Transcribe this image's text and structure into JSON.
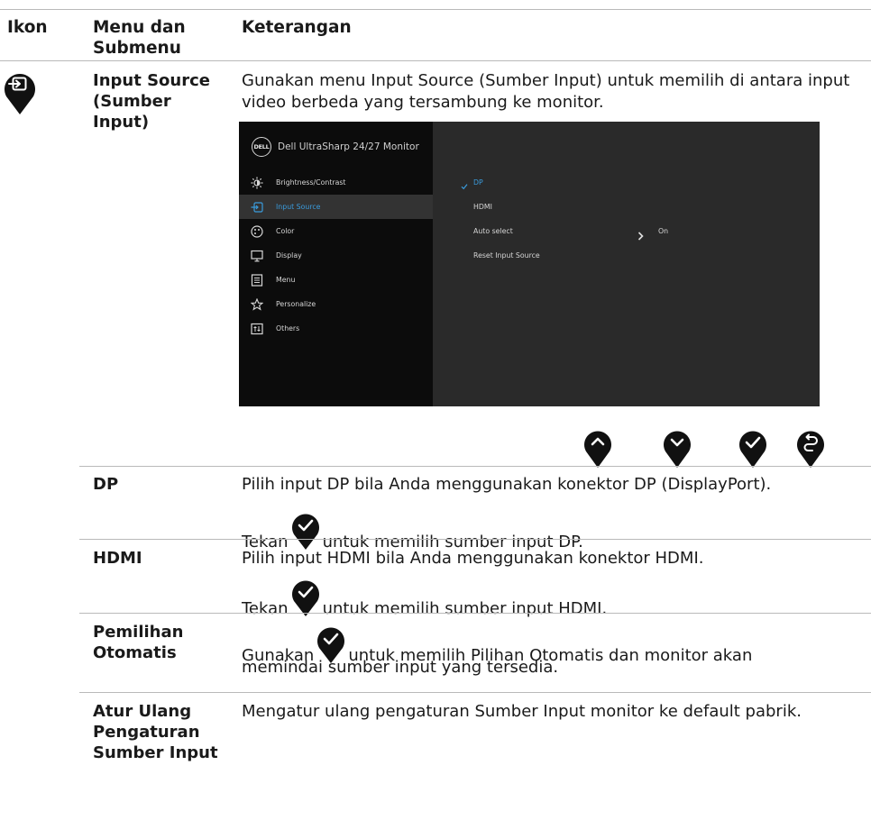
{
  "header": {
    "col_icon": "Ikon",
    "col_menu": "Menu dan Submenu",
    "col_desc": "Keterangan"
  },
  "input_source": {
    "title": "Input Source (Sumber Input)",
    "description": "Gunakan menu Input Source (Sumber Input) untuk memilih di antara input video berbeda yang tersambung ke monitor."
  },
  "osd": {
    "logo": "DELL",
    "title": "Dell UltraSharp 24/27 Monitor",
    "menu_items": [
      {
        "label": "Brightness/Contrast",
        "icon": "brightness-icon"
      },
      {
        "label": "Input Source",
        "icon": "input-source-icon"
      },
      {
        "label": "Color",
        "icon": "palette-icon"
      },
      {
        "label": "Display",
        "icon": "display-icon"
      },
      {
        "label": "Menu",
        "icon": "menu-icon"
      },
      {
        "label": "Personalize",
        "icon": "star-icon"
      },
      {
        "label": "Others",
        "icon": "others-icon"
      }
    ],
    "sub_items": [
      "DP",
      "HDMI",
      "Auto select",
      "Reset Input Source"
    ],
    "auto_select_value": "On",
    "selected": "DP"
  },
  "nav_buttons": [
    "up-icon",
    "down-icon",
    "check-icon",
    "back-icon"
  ],
  "rows": [
    {
      "label": "DP",
      "line1": "Pilih input DP bila Anda menggunakan konektor DP (DisplayPort).",
      "line2_before": "Tekan",
      "line2_after": "untuk memilih sumber input DP."
    },
    {
      "label": "HDMI",
      "line1": "Pilih input HDMI bila Anda menggunakan konektor HDMI.",
      "line2_before": "Tekan",
      "line2_after": "untuk memilih sumber input HDMI."
    },
    {
      "label": "Pemilihan Otomatis",
      "line1_before": "Gunakan",
      "line1_after": "untuk memilih Pilihan Otomatis dan monitor akan",
      "line2": "memindai sumber input yang tersedia."
    },
    {
      "label": "Atur Ulang Pengaturan Sumber Input",
      "line1": "Mengatur ulang pengaturan Sumber Input monitor ke default pabrik."
    }
  ],
  "colors": {
    "osd_background": "#0c0c0c",
    "osd_panel": "#2a2a2a",
    "osd_accent": "#3a9bdc",
    "pin": "#111111"
  }
}
